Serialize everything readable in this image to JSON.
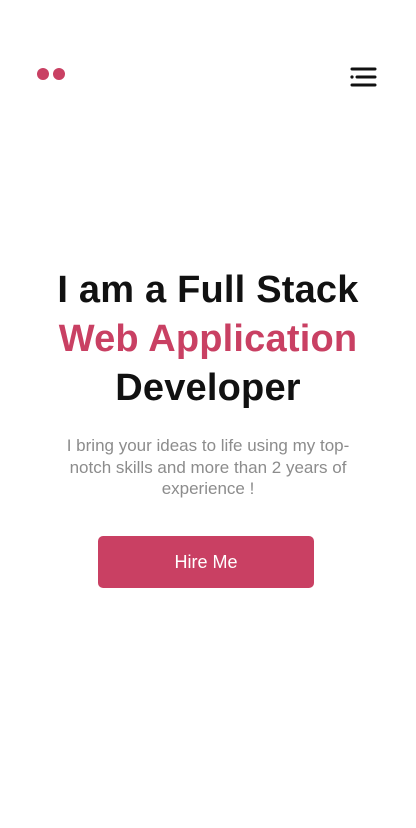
{
  "header": {
    "logo_icon": "two-dots-logo-icon",
    "menu_icon": "hamburger-menu-icon"
  },
  "hero": {
    "headline_line1": "I am a Full Stack",
    "headline_line2": "Web Application",
    "headline_line3": "Developer",
    "subtitle": "I bring your ideas to life using my top-notch skills and more than 2 years of experience !",
    "cta_label": "Hire Me"
  },
  "colors": {
    "accent": "#c94063",
    "text": "#111111",
    "muted": "#8c8c8c",
    "background": "#ffffff"
  }
}
